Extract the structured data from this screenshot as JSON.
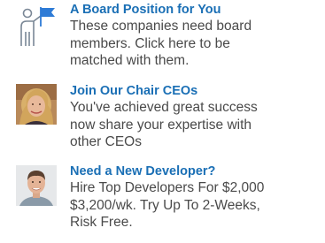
{
  "ads": [
    {
      "title": "A Board Position for You",
      "description_lines": [
        "These companies need board",
        "members. Click here to be",
        "matched with them."
      ],
      "icon": "board-member-flag-icon"
    },
    {
      "title": "Join Our Chair CEOs",
      "description_lines": [
        "You've achieved great success",
        "now share your expertise with",
        "other CEOs"
      ],
      "icon": "woman-portrait"
    },
    {
      "title": "Need a New Developer?",
      "description_lines": [
        "Hire Top Developers For $2,000",
        "$3,200/wk. Try Up To 2-Weeks,",
        "Risk Free."
      ],
      "icon": "man-portrait"
    }
  ],
  "colors": {
    "title": "#1a6fb5",
    "description": "#4a4a4a",
    "icon_blue": "#2e7bd6"
  }
}
